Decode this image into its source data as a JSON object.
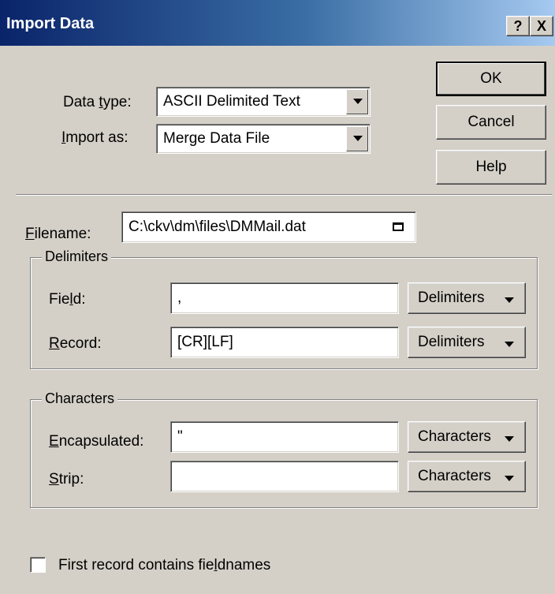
{
  "title": "Import Data",
  "title_buttons": {
    "help": "?",
    "close": "X"
  },
  "buttons": {
    "ok": "OK",
    "cancel": "Cancel",
    "help": "Help"
  },
  "data_type": {
    "label_pre": "Data ",
    "label_mnemonic": "t",
    "label_post": "ype:",
    "value": "ASCII Delimited Text"
  },
  "import_as": {
    "label_mnemonic": "I",
    "label_post": "mport as:",
    "value": "Merge Data File"
  },
  "filename": {
    "label_mnemonic": "F",
    "label_post": "ilename:",
    "value": "C:\\ckv\\dm\\files\\DMMail.dat"
  },
  "delimiters": {
    "title": "Delimiters",
    "field": {
      "label_pre": "Fie",
      "label_mnemonic": "l",
      "label_post": "d:",
      "value": ",",
      "button": "Delimiters"
    },
    "record": {
      "label_mnemonic": "R",
      "label_post": "ecord:",
      "value": "[CR][LF]",
      "button": "Delimiters"
    }
  },
  "characters": {
    "title": "Characters",
    "encapsulated": {
      "label_mnemonic": "E",
      "label_post": "ncapsulated:",
      "value": "\"",
      "button": "Characters"
    },
    "strip": {
      "label_mnemonic": "S",
      "label_post": "trip:",
      "value": "",
      "button": "Characters"
    }
  },
  "first_record": {
    "label_pre": "First record contains fie",
    "label_mnemonic": "l",
    "label_post": "dnames",
    "checked": false
  },
  "icons": {
    "browse": "folder-browse-icon",
    "help": "help-icon",
    "close": "close-icon"
  }
}
